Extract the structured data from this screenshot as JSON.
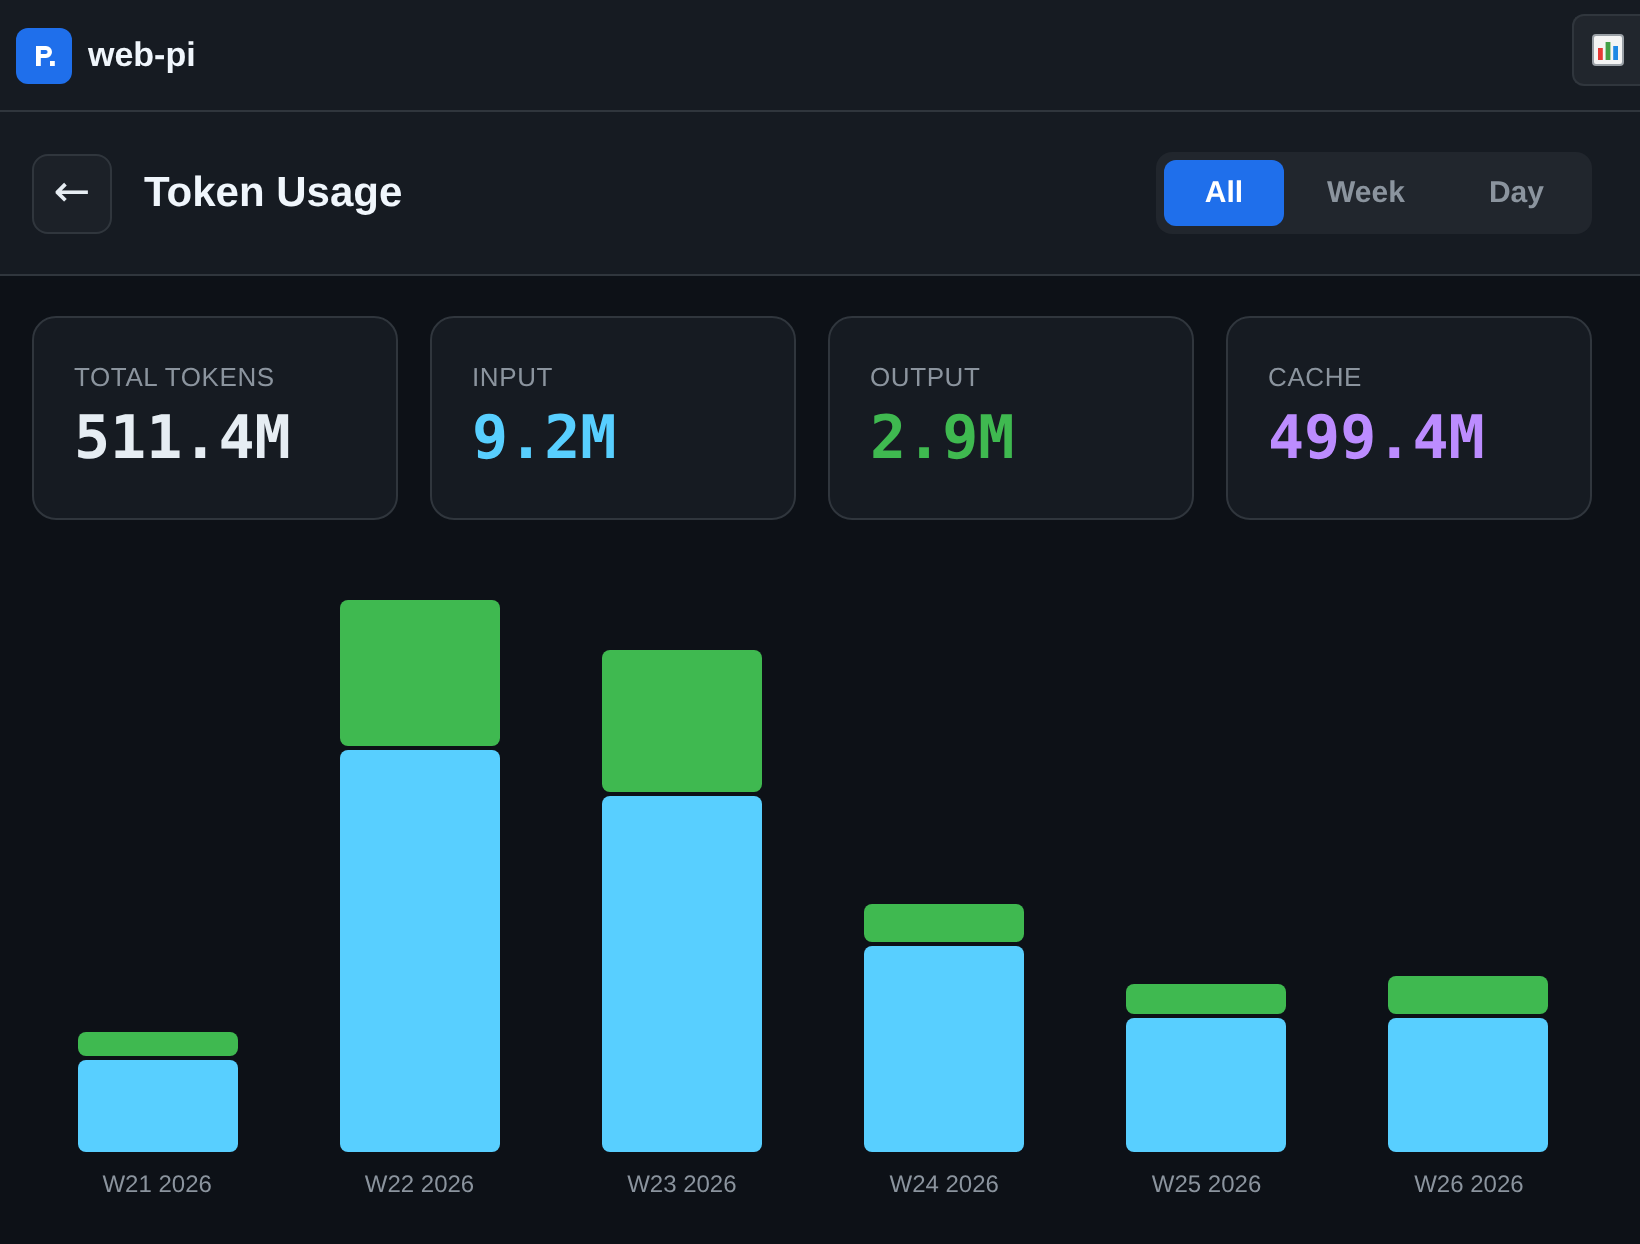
{
  "app": {
    "name": "web-pi"
  },
  "header": {
    "back": "←",
    "title": "Token Usage",
    "ranges": [
      {
        "label": "All",
        "selected": true
      },
      {
        "label": "Week",
        "selected": false
      },
      {
        "label": "Day",
        "selected": false
      }
    ]
  },
  "stats": [
    {
      "label": "TOTAL TOKENS",
      "value": "511.4M",
      "color": "#e6edf3"
    },
    {
      "label": "INPUT",
      "value": "9.2M",
      "color": "#58cfff"
    },
    {
      "label": "OUTPUT",
      "value": "2.9M",
      "color": "#3fb950"
    },
    {
      "label": "CACHE",
      "value": "499.4M",
      "color": "#bc8cff"
    }
  ],
  "chart": {
    "bars": [
      {
        "label": "W21 2026"
      },
      {
        "label": "W22 2026"
      },
      {
        "label": "W23 2026"
      },
      {
        "label": "W24 2026"
      },
      {
        "label": "W25 2026"
      },
      {
        "label": "W26 2026"
      }
    ]
  }
}
